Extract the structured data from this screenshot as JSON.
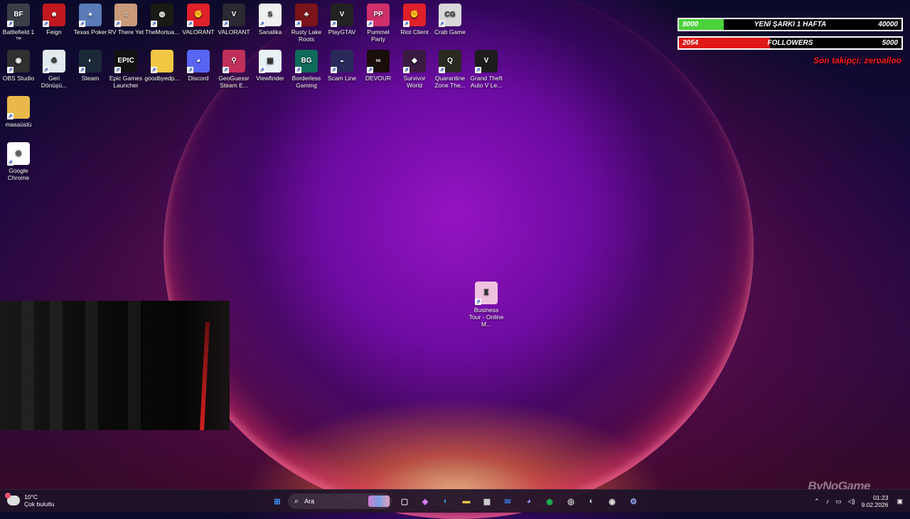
{
  "desktop": {
    "icons": [
      {
        "label": "Battlefield 1",
        "sub": "™",
        "bg": "#3a3f48",
        "glyph": "BF"
      },
      {
        "label": "Feign",
        "bg": "#c0181e",
        "glyph": "☻"
      },
      {
        "label": "Texas Poker",
        "bg": "#5a7bb8",
        "glyph": "♠"
      },
      {
        "label": "RV There Yet",
        "bg": "#c89a7a",
        "glyph": "☺"
      },
      {
        "label": "TheMortua...",
        "bg": "#1a1a14",
        "glyph": "◍"
      },
      {
        "label": "VALORANT",
        "bg": "#e0202a",
        "glyph": "✊"
      },
      {
        "label": "VALORANT",
        "bg": "#2a2830",
        "glyph": "V"
      },
      {
        "label": "Sanalika",
        "bg": "#f0f0f0",
        "glyph": "S"
      },
      {
        "label": "Rusty Lake Roots",
        "bg": "#7a1418",
        "glyph": "♣"
      },
      {
        "label": "PlayGTAV",
        "bg": "#222",
        "glyph": "V"
      },
      {
        "label": "Pummel Party",
        "bg": "#d0306a",
        "glyph": "PP"
      },
      {
        "label": "Riot Client",
        "bg": "#e0202a",
        "glyph": "✊"
      },
      {
        "label": "Crab Game",
        "bg": "#d8d8d8",
        "glyph": "CG"
      },
      {
        "label": "OBS Studio",
        "bg": "#303030",
        "glyph": "◉"
      },
      {
        "label": "Geri Dönüşü...",
        "bg": "#e0eaf0",
        "glyph": "♻"
      },
      {
        "label": "Steam",
        "bg": "#1b2838",
        "glyph": "◐"
      },
      {
        "label": "Epic Games Launcher",
        "bg": "#111",
        "glyph": "EPIC"
      },
      {
        "label": "goodbyedp...",
        "bg": "#f2c744",
        "glyph": ""
      },
      {
        "label": "Discord",
        "bg": "#5865f2",
        "glyph": "◕"
      },
      {
        "label": "GeoGuessr Steam E...",
        "bg": "#c0305a",
        "glyph": "⚲"
      },
      {
        "label": "Viewfinder",
        "bg": "#e8f0f8",
        "glyph": "▣"
      },
      {
        "label": "Borderless Gaming",
        "bg": "#0f6b5a",
        "glyph": "BG"
      },
      {
        "label": "Scam Line",
        "bg": "#2a2a5a",
        "glyph": "◒"
      },
      {
        "label": "DEVOUR",
        "bg": "#1a0e0a",
        "glyph": "∞"
      },
      {
        "label": "Survivor World",
        "bg": "#3a1a40",
        "glyph": "◆"
      },
      {
        "label": "Quarantine Zone The...",
        "bg": "#2a2a20",
        "glyph": "Q"
      },
      {
        "label": "Grand Theft Auto V Le...",
        "bg": "#1c1c1c",
        "glyph": "V"
      },
      {
        "label": "masaüstü",
        "bg": "#e8b84a",
        "glyph": ""
      },
      {
        "label": "Google Chrome",
        "bg": "#ffffff",
        "glyph": "◎"
      },
      {
        "label": "Business Tour - Online M...",
        "bg": "#f0c0e0",
        "glyph": "♜"
      }
    ]
  },
  "overlay": {
    "goal_bar": {
      "left": "8000",
      "center": "YENİ ŞARKI 1 HAFTA",
      "right": "40000",
      "progress": 0.2,
      "color": "#4bd23a"
    },
    "follower_bar": {
      "left": "2054",
      "center": "FOLLOWERS",
      "right": "5000",
      "progress": 0.41,
      "color": "#e01818"
    },
    "last_follower": "Son takipçi: zeroalloo",
    "watermark": "ByNoGame"
  },
  "taskbar": {
    "weather": {
      "temp": "10°C",
      "desc": "Çok bulutlu"
    },
    "search_placeholder": "Ara",
    "apps": [
      {
        "name": "start-icon",
        "glyph": "⊞",
        "color": "#3b9cff"
      },
      {
        "name": "task-view-icon",
        "glyph": "▢",
        "color": "#ddd"
      },
      {
        "name": "copilot-icon",
        "glyph": "◈",
        "color": "#e080ff"
      },
      {
        "name": "edge-icon",
        "glyph": "◐",
        "color": "#2fa0e0"
      },
      {
        "name": "file-explorer-icon",
        "glyph": "▬",
        "color": "#f2c744"
      },
      {
        "name": "store-icon",
        "glyph": "▦",
        "color": "#ddd"
      },
      {
        "name": "mail-icon",
        "glyph": "✉",
        "color": "#3a7ae0"
      },
      {
        "name": "discord-icon",
        "glyph": "◕",
        "color": "#8a95ff"
      },
      {
        "name": "spotify-icon",
        "glyph": "◉",
        "color": "#1db954"
      },
      {
        "name": "chrome-icon",
        "glyph": "◎",
        "color": "#e8e8e8"
      },
      {
        "name": "steam-icon",
        "glyph": "◐",
        "color": "#c8d8f0"
      },
      {
        "name": "obs-icon",
        "glyph": "◉",
        "color": "#ddd"
      },
      {
        "name": "app-icon",
        "glyph": "⚙",
        "color": "#9ab0ff"
      }
    ],
    "clock": {
      "time": "01:23",
      "date": "9.02.2026"
    }
  }
}
